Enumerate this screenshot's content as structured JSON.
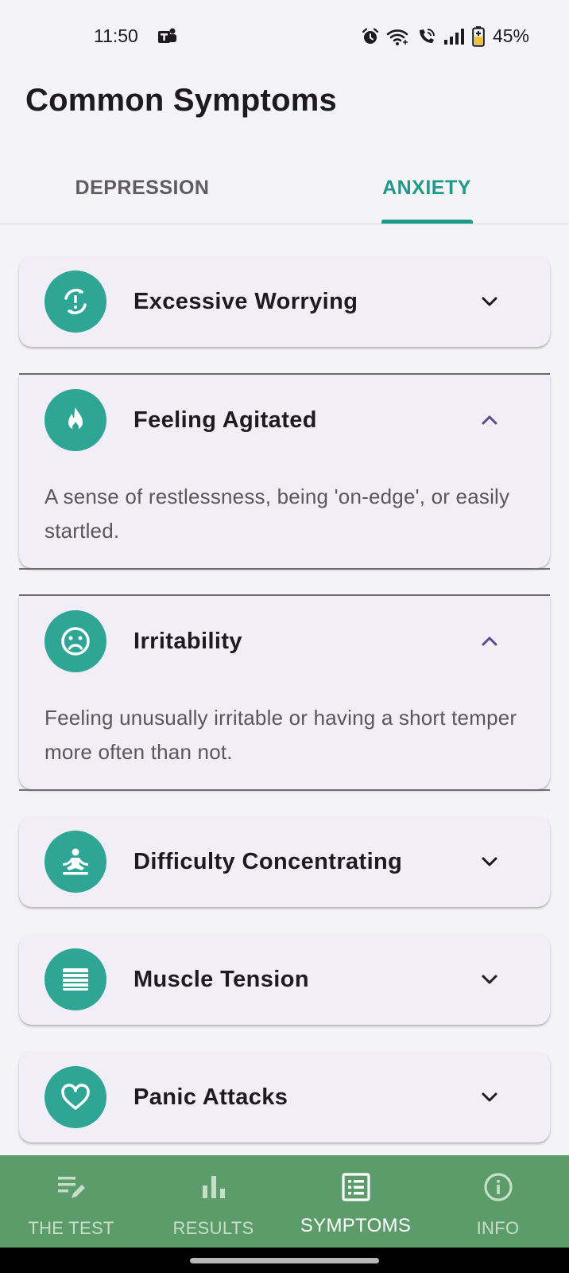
{
  "status_bar": {
    "time": "11:50",
    "battery": "45%",
    "icons": [
      "teams-icon",
      "alarm-icon",
      "wifi-icon",
      "wifi-call-icon",
      "signal-icon",
      "battery-charging-icon"
    ]
  },
  "header": {
    "title": "Common Symptoms"
  },
  "tabs": [
    {
      "label": "DEPRESSION",
      "selected": false
    },
    {
      "label": "ANXIETY",
      "selected": true
    }
  ],
  "symptoms": [
    {
      "title": "Excessive Worrying",
      "icon": "worry-cycle-icon",
      "expanded": false,
      "description": ""
    },
    {
      "title": "Feeling Agitated",
      "icon": "flame-icon",
      "expanded": true,
      "description": "A sense of restlessness, being 'on-edge', or easily startled."
    },
    {
      "title": "Irritability",
      "icon": "sad-face-icon",
      "expanded": true,
      "description": "Feeling unusually irritable or having a short temper more often than not."
    },
    {
      "title": "Difficulty Concentrating",
      "icon": "meditation-icon",
      "expanded": false,
      "description": ""
    },
    {
      "title": "Muscle Tension",
      "icon": "tension-lines-icon",
      "expanded": false,
      "description": ""
    },
    {
      "title": "Panic Attacks",
      "icon": "heart-icon",
      "expanded": false,
      "description": ""
    }
  ],
  "bottom_nav": [
    {
      "label": "THE TEST",
      "icon": "edit-list-icon",
      "active": false
    },
    {
      "label": "RESULTS",
      "icon": "bar-chart-icon",
      "active": false
    },
    {
      "label": "SYMPTOMS",
      "icon": "list-alt-icon",
      "active": true
    },
    {
      "label": "INFO",
      "icon": "info-icon",
      "active": false
    }
  ],
  "colors": {
    "accent": "#1d9a8a",
    "icon_circle": "#2fa596",
    "card_bg": "#f2eef8",
    "bottom_nav_bg": "#5c9c6a",
    "expanded_chevron": "#5b4a8b"
  }
}
